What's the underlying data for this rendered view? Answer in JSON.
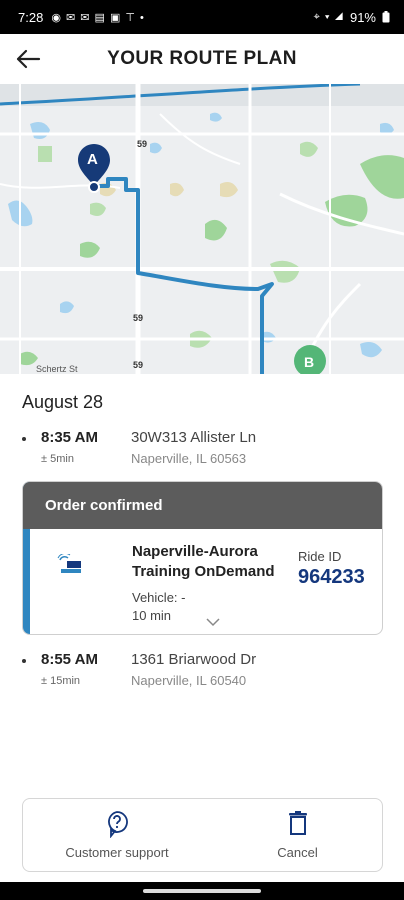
{
  "status": {
    "time": "7:28",
    "left_icons": "◉ ✉ ✉ ▤ ▣ ⊤ •",
    "right_icons": "⌖ ▾ ◢",
    "battery": "91%"
  },
  "header": {
    "title": "YOUR ROUTE PLAN"
  },
  "map": {
    "road_labels": [
      "59",
      "59",
      "59"
    ],
    "marker_a": "A",
    "marker_b": "B",
    "street_label": "Schertz St"
  },
  "trip": {
    "date": "August 28",
    "origin": {
      "time": "8:35 AM",
      "tolerance": "± 5min",
      "address_line1": "30W313 Allister Ln",
      "address_line2": "Naperville, IL 60563"
    },
    "order": {
      "status": "Order confirmed",
      "service_name": "Naperville-Aurora Training OnDemand",
      "vehicle_label": "Vehicle: -",
      "duration": "10 min",
      "ride_id_label": "Ride ID",
      "ride_id": "964233",
      "logo_text": "ON DEMAND"
    },
    "destination": {
      "time": "8:55 AM",
      "tolerance": "± 15min",
      "address_line1": "1361 Briarwood Dr",
      "address_line2": "Naperville, IL 60540"
    }
  },
  "actions": {
    "support_label": "Customer support",
    "cancel_label": "Cancel"
  },
  "colors": {
    "accent": "#2f86c0",
    "ride_id": "#14377d",
    "order_header": "#5c5c5c",
    "route": "#2f86c0",
    "marker_a": "#163a78",
    "marker_b": "#54b677"
  }
}
